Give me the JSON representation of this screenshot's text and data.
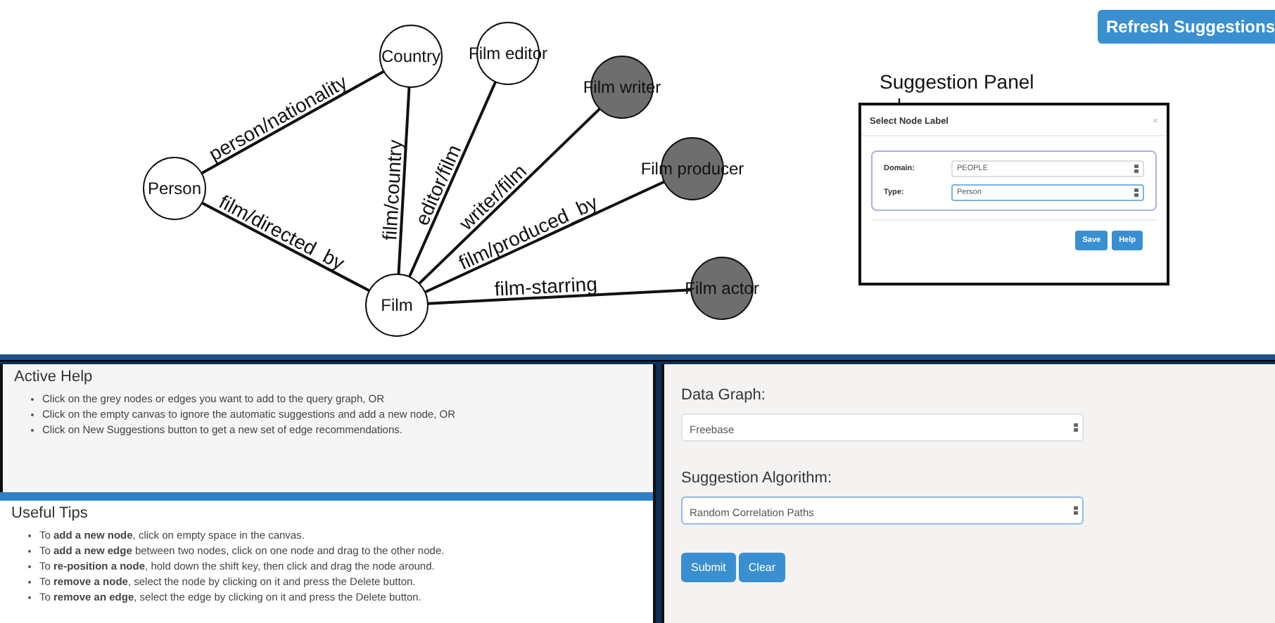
{
  "toolbar": {
    "refresh_button": "Refresh Suggestions"
  },
  "graph": {
    "nodes": [
      {
        "label": "Person",
        "suggested": false
      },
      {
        "label": "Country",
        "suggested": false
      },
      {
        "label": "Film editor",
        "suggested": false
      },
      {
        "label": "Film writer",
        "suggested": true
      },
      {
        "label": "Film producer",
        "suggested": true
      },
      {
        "label": "Film actor",
        "suggested": true
      },
      {
        "label": "Film",
        "suggested": false
      }
    ],
    "edges": [
      {
        "label": "person/nationality"
      },
      {
        "label": "film/directed_by"
      },
      {
        "label": "film/country"
      },
      {
        "label": "editor/film"
      },
      {
        "label": "writer/film"
      },
      {
        "label": "film/produced_by"
      },
      {
        "label": "film-starring"
      }
    ]
  },
  "annotation": {
    "label": "Suggestion Panel"
  },
  "suggestion_panel": {
    "title": "Select Node Label",
    "close": "×",
    "fields": [
      {
        "label": "Domain:",
        "value": "PEOPLE",
        "focused": false
      },
      {
        "label": "Type:",
        "value": "Person",
        "focused": true
      }
    ],
    "buttons": [
      "Save",
      "Help"
    ]
  },
  "active_help": {
    "title": "Active Help",
    "items": [
      "Click on the grey nodes or edges you want to add to the query graph, OR",
      "Click on the empty canvas to ignore the automatic suggestions and add a new node, OR",
      "Click on New Suggestions button to get a new set of edge recommendations."
    ]
  },
  "useful_tips": {
    "title": "Useful Tips",
    "items": [
      "To **add a new node**, click on empty space in the canvas.",
      "To **add a new edge** between two nodes, click on one node and drag to the other node.",
      "To **re-position a node**, hold down the shift key, then click and drag the node around.",
      "To **remove a node**, select the node by clicking on it and press the Delete button.",
      "To **remove an edge**, select the edge by clicking on it and press the Delete button."
    ]
  },
  "settings": {
    "fields": [
      {
        "label": "Data Graph:",
        "value": "Freebase",
        "focused": false
      },
      {
        "label": "Suggestion Algorithm:",
        "value": "Random Correlation Paths",
        "focused": true
      }
    ],
    "buttons": [
      "Submit",
      "Clear"
    ]
  }
}
